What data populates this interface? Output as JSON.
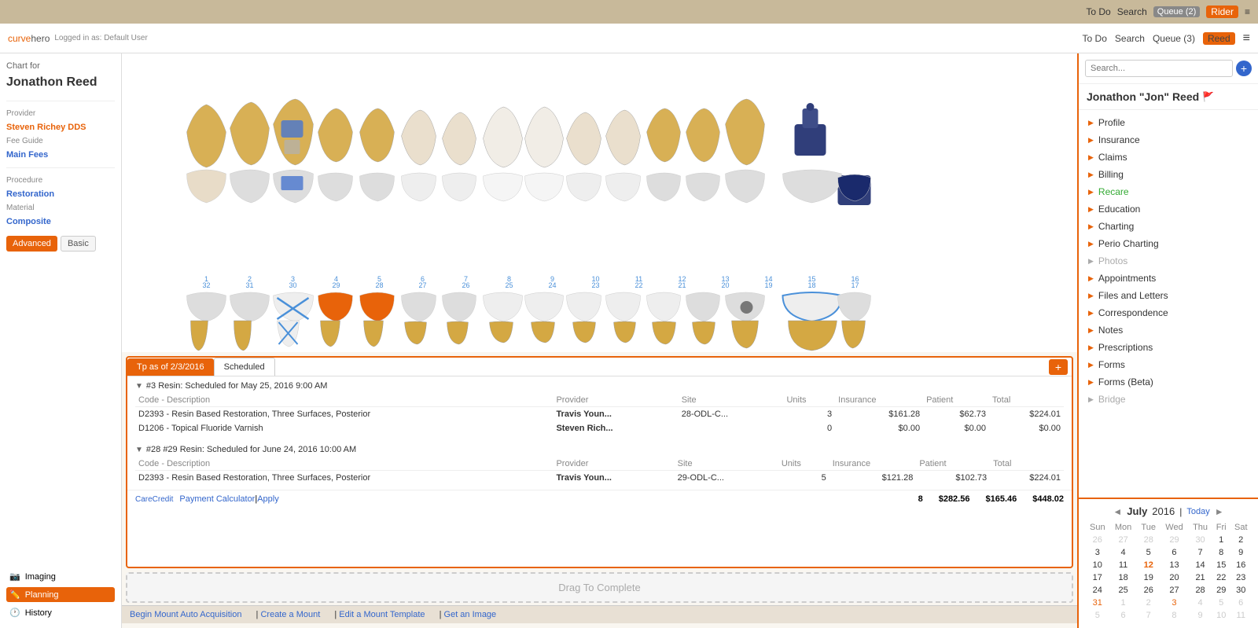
{
  "topbar": {
    "todo": "To Do",
    "search": "Search",
    "queue_label": "Queue (2)",
    "active_tab": "Rider",
    "hamburger": "≡"
  },
  "navbar": {
    "logo_curve": "curve",
    "logo_hero": "hero",
    "logged_in": "Logged in as: Default User",
    "todo": "To Do",
    "search": "Search",
    "queue_label": "Queue (3)",
    "active_tab": "Reed",
    "hamburger": "≡"
  },
  "left_panel": {
    "chart_for": "Chart for",
    "patient_name": "Jonathon Reed",
    "provider_label": "Provider",
    "provider_value": "Steven Richey DDS",
    "fee_guide_label": "Fee Guide",
    "fee_guide_value": "Main Fees",
    "procedure_label": "Procedure",
    "procedure_value": "Restoration",
    "material_label": "Material",
    "material_value": "Composite",
    "btn_advanced": "Advanced",
    "btn_basic": "Basic"
  },
  "bottom_icons": {
    "imaging": "Imaging",
    "planning": "Planning",
    "history": "History"
  },
  "treatment_plan": {
    "tab_tp": "Tp as of 2/3/2016",
    "tab_scheduled": "Scheduled",
    "add_btn": "+",
    "section1": {
      "header": "#3 Resin: Scheduled for May 25, 2016 9:00 AM",
      "col_code": "Code - Description",
      "col_provider": "Provider",
      "col_site": "Site",
      "col_units": "Units",
      "col_insurance": "Insurance",
      "col_patient": "Patient",
      "col_total": "Total",
      "rows": [
        {
          "code": "D2393 - Resin Based Restoration, Three Surfaces, Posterior",
          "provider": "Travis Youn...",
          "site": "28-ODL-C...",
          "units": "3",
          "insurance": "$161.28",
          "patient": "$62.73",
          "total": "$224.01"
        },
        {
          "code": "D1206 - Topical Fluoride Varnish",
          "provider": "Steven Rich...",
          "site": "",
          "units": "0",
          "insurance": "$0.00",
          "patient": "$0.00",
          "total": "$0.00"
        }
      ]
    },
    "section2": {
      "header": "#28 #29 Resin: Scheduled for June 24, 2016 10:00 AM",
      "col_code": "Code - Description",
      "col_provider": "Provider",
      "col_site": "Site",
      "col_units": "Units",
      "col_insurance": "Insurance",
      "col_patient": "Patient",
      "col_total": "Total",
      "rows": [
        {
          "code": "D2393 - Resin Based Restoration, Three Surfaces, Posterior",
          "provider": "Travis Youn...",
          "site": "29-ODL-C...",
          "units": "5",
          "insurance": "$121.28",
          "patient": "$102.73",
          "total": "$224.01"
        }
      ]
    },
    "footer": {
      "care_credit": "CareCredit",
      "payment_calc": "Payment Calculator",
      "apply": "Apply",
      "total_units": "8",
      "total_insurance": "$282.56",
      "total_patient": "$165.46",
      "total": "$448.02"
    },
    "drag_complete": "Drag To Complete"
  },
  "bottom_toolbar": {
    "links": [
      "Begin Mount Auto Acquisition",
      "Create a Mount",
      "Edit a Mount Template",
      "Get an Image"
    ]
  },
  "right_panel": {
    "search_placeholder": "Search...",
    "add_btn": "+",
    "patient_name": "Jonathon \"Jon\" Reed",
    "nav_items": [
      {
        "label": "Profile",
        "disabled": false,
        "green": false
      },
      {
        "label": "Insurance",
        "disabled": false,
        "green": false
      },
      {
        "label": "Claims",
        "disabled": false,
        "green": false
      },
      {
        "label": "Billing",
        "disabled": false,
        "green": false
      },
      {
        "label": "Recare",
        "disabled": false,
        "green": true
      },
      {
        "label": "Education",
        "disabled": false,
        "green": false
      },
      {
        "label": "Charting",
        "disabled": false,
        "green": false
      },
      {
        "label": "Perio Charting",
        "disabled": false,
        "green": false
      },
      {
        "label": "Photos",
        "disabled": true,
        "green": false
      },
      {
        "label": "Appointments",
        "disabled": false,
        "green": false
      },
      {
        "label": "Files and Letters",
        "disabled": false,
        "green": false
      },
      {
        "label": "Correspondence",
        "disabled": false,
        "green": false
      },
      {
        "label": "Notes",
        "disabled": false,
        "green": false
      },
      {
        "label": "Prescriptions",
        "disabled": false,
        "green": false
      },
      {
        "label": "Forms",
        "disabled": false,
        "green": false
      },
      {
        "label": "Forms (Beta)",
        "disabled": false,
        "green": false
      },
      {
        "label": "Bridge",
        "disabled": true,
        "green": false
      }
    ]
  },
  "calendar": {
    "prev": "◄",
    "next": "►",
    "month": "July",
    "year": "2016",
    "today_btn": "Today",
    "day_headers": [
      "Sun",
      "Mon",
      "Tue",
      "Wed",
      "Thu",
      "Fri",
      "Sat"
    ],
    "weeks": [
      [
        {
          "day": "26",
          "other": true,
          "today": false,
          "appt": false
        },
        {
          "day": "27",
          "other": true,
          "today": false,
          "appt": false
        },
        {
          "day": "28",
          "other": true,
          "today": false,
          "appt": false
        },
        {
          "day": "29",
          "other": true,
          "today": false,
          "appt": false
        },
        {
          "day": "30",
          "other": true,
          "today": false,
          "appt": false
        },
        {
          "day": "1",
          "other": false,
          "today": false,
          "appt": false
        },
        {
          "day": "2",
          "other": false,
          "today": false,
          "appt": false
        }
      ],
      [
        {
          "day": "3",
          "other": false,
          "today": false,
          "appt": false
        },
        {
          "day": "4",
          "other": false,
          "today": false,
          "appt": false
        },
        {
          "day": "5",
          "other": false,
          "today": false,
          "appt": false
        },
        {
          "day": "6",
          "other": false,
          "today": false,
          "appt": false
        },
        {
          "day": "7",
          "other": false,
          "today": false,
          "appt": false
        },
        {
          "day": "8",
          "other": false,
          "today": false,
          "appt": false
        },
        {
          "day": "9",
          "other": false,
          "today": false,
          "appt": false
        }
      ],
      [
        {
          "day": "10",
          "other": false,
          "today": false,
          "appt": false
        },
        {
          "day": "11",
          "other": false,
          "today": false,
          "appt": false
        },
        {
          "day": "12",
          "other": false,
          "today": true,
          "appt": false
        },
        {
          "day": "13",
          "other": false,
          "today": false,
          "appt": false
        },
        {
          "day": "14",
          "other": false,
          "today": false,
          "appt": false
        },
        {
          "day": "15",
          "other": false,
          "today": false,
          "appt": false
        },
        {
          "day": "16",
          "other": false,
          "today": false,
          "appt": false
        }
      ],
      [
        {
          "day": "17",
          "other": false,
          "today": false,
          "appt": false
        },
        {
          "day": "18",
          "other": false,
          "today": false,
          "appt": false
        },
        {
          "day": "19",
          "other": false,
          "today": false,
          "appt": false
        },
        {
          "day": "20",
          "other": false,
          "today": false,
          "appt": false
        },
        {
          "day": "21",
          "other": false,
          "today": false,
          "appt": false
        },
        {
          "day": "22",
          "other": false,
          "today": false,
          "appt": false
        },
        {
          "day": "23",
          "other": false,
          "today": false,
          "appt": false
        }
      ],
      [
        {
          "day": "24",
          "other": false,
          "today": false,
          "appt": false
        },
        {
          "day": "25",
          "other": false,
          "today": false,
          "appt": false
        },
        {
          "day": "26",
          "other": false,
          "today": false,
          "appt": false
        },
        {
          "day": "27",
          "other": false,
          "today": false,
          "appt": false
        },
        {
          "day": "28",
          "other": false,
          "today": false,
          "appt": false
        },
        {
          "day": "29",
          "other": false,
          "today": false,
          "appt": false
        },
        {
          "day": "30",
          "other": false,
          "today": false,
          "appt": false
        }
      ],
      [
        {
          "day": "31",
          "other": false,
          "today": false,
          "appt": true
        },
        {
          "day": "1",
          "other": true,
          "today": false,
          "appt": false
        },
        {
          "day": "2",
          "other": true,
          "today": false,
          "appt": false
        },
        {
          "day": "3",
          "other": true,
          "today": false,
          "appt": true
        },
        {
          "day": "4",
          "other": true,
          "today": false,
          "appt": false
        },
        {
          "day": "5",
          "other": true,
          "today": false,
          "appt": false
        },
        {
          "day": "6",
          "other": true,
          "today": false,
          "appt": false
        }
      ],
      [
        {
          "day": "5",
          "other": true,
          "today": false,
          "appt": false
        },
        {
          "day": "6",
          "other": true,
          "today": false,
          "appt": false
        },
        {
          "day": "7",
          "other": true,
          "today": false,
          "appt": false
        },
        {
          "day": "8",
          "other": true,
          "today": false,
          "appt": false
        },
        {
          "day": "9",
          "other": true,
          "today": false,
          "appt": false
        },
        {
          "day": "10",
          "other": true,
          "today": false,
          "appt": false
        },
        {
          "day": "11",
          "other": true,
          "today": false,
          "appt": false
        }
      ]
    ]
  },
  "tooth_numbers_upper": [
    "1",
    "2",
    "3",
    "4",
    "5",
    "6",
    "7",
    "8",
    "9",
    "10",
    "11",
    "12",
    "13",
    "14",
    "15",
    "16"
  ],
  "tooth_numbers_lower": [
    "32",
    "31",
    "30",
    "29",
    "28",
    "27",
    "26",
    "25",
    "24",
    "23",
    "22",
    "21",
    "20",
    "19",
    "18",
    "17"
  ]
}
